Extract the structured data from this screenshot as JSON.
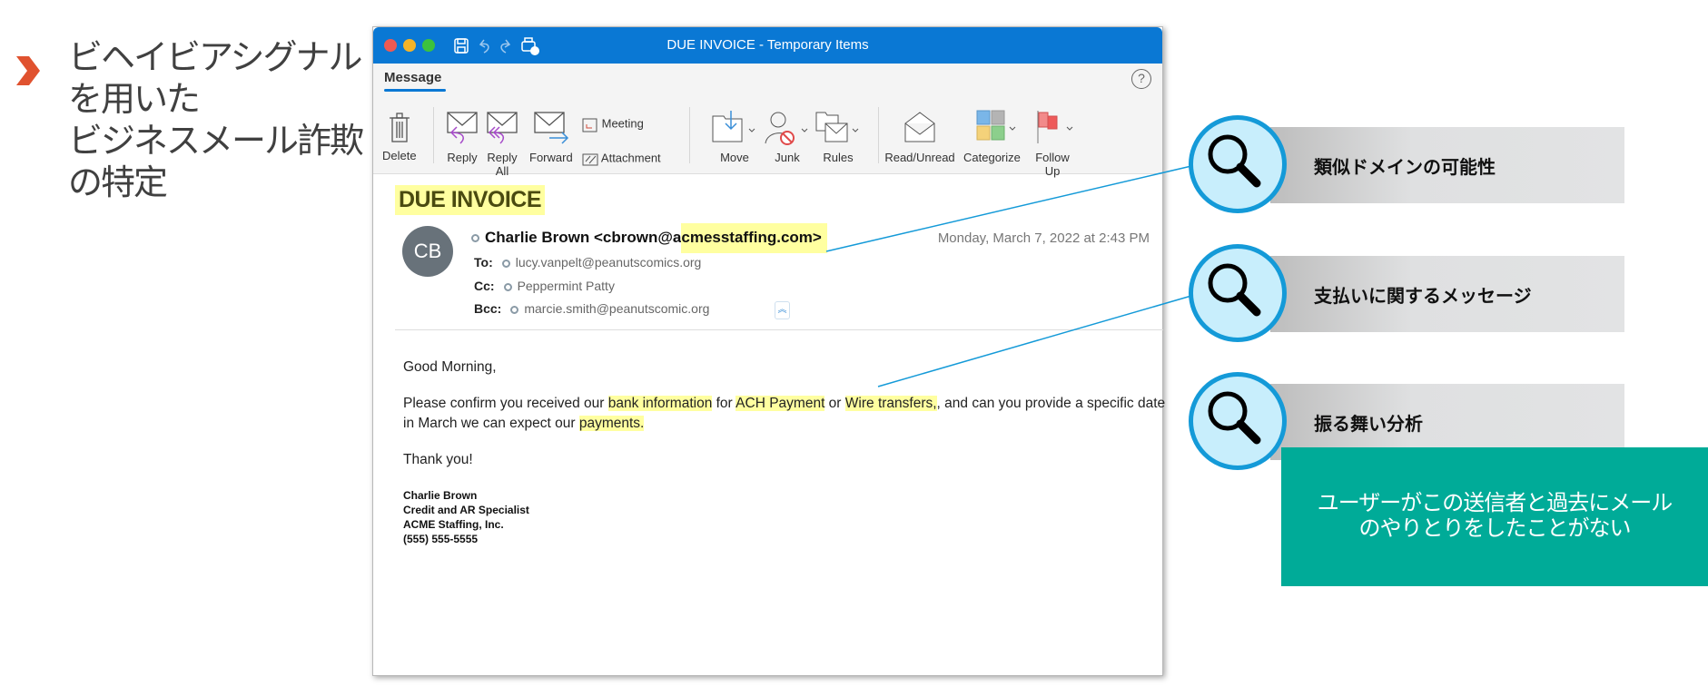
{
  "slide": {
    "title_lines": [
      "ビヘイビアシグナル",
      "を用いた",
      "ビジネスメール詐欺",
      "の特定"
    ],
    "accent": "#e0522f"
  },
  "window": {
    "title": "DUE INVOICE - Temporary Items",
    "titlebar_color": "#0a78d4"
  },
  "ribbon": {
    "tab": "Message",
    "help": "?",
    "buttons": {
      "delete": "Delete",
      "reply": "Reply",
      "reply_all": "Reply All",
      "forward": "Forward",
      "meeting": "Meeting",
      "attachment": "Attachment",
      "move": "Move",
      "junk": "Junk",
      "rules": "Rules",
      "read_unread": "Read/Unread",
      "categorize": "Categorize",
      "follow_up": "Follow Up"
    }
  },
  "email": {
    "subject": "DUE INVOICE",
    "avatar": "CB",
    "sender_prefix": "Charlie Brown <cbrown@a",
    "sender_highlight": "cmesstaffing.com>",
    "date": "Monday, March 7, 2022 at 2:43 PM",
    "to_label": "To:",
    "to": "lucy.vanpelt@peanutscomics.org",
    "cc_label": "Cc:",
    "cc": "Peppermint Patty",
    "bcc_label": "Bcc:",
    "bcc": "marcie.smith@peanutscomic.org",
    "greeting": "Good Morning,",
    "p1": [
      "Please confirm you received our ",
      "bank information",
      " for ",
      "ACH Payment",
      " or ",
      "Wire transfers,",
      ", and can you provide a specific date"
    ],
    "p2": [
      "in March we can expect our ",
      "payments."
    ],
    "thanks": "Thank you!",
    "signature": [
      "Charlie Brown",
      "Credit and AR Specialist",
      "ACME Staffing, Inc.",
      "(555) 555-5555"
    ]
  },
  "callouts": [
    {
      "label": "類似ドメインの可能性",
      "icon": "search-icon"
    },
    {
      "label": "支払いに関するメッセージ",
      "icon": "search-icon"
    },
    {
      "label": "振る舞い分析",
      "icon": "search-icon"
    }
  ],
  "behavior_note": [
    "ユーザーがこの送信者と過去にメール",
    "のやりとりをしたことがない"
  ],
  "colors": {
    "highlight": "#ffffa0",
    "callout_ring": "#149ad8",
    "note_bg": "#00ab98"
  }
}
